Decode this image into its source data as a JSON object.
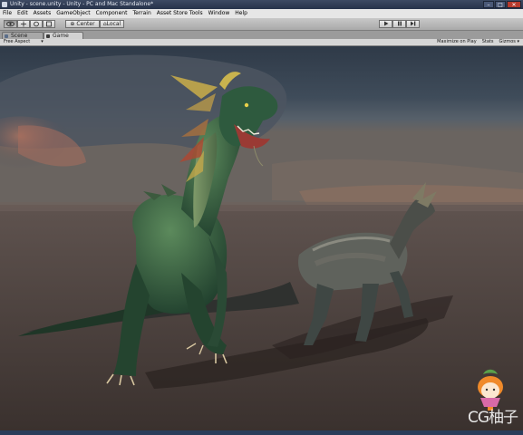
{
  "window": {
    "title": "Unity - scene.unity - Unity - PC and Mac Standalone*"
  },
  "menu": [
    "File",
    "Edit",
    "Assets",
    "GameObject",
    "Component",
    "Terrain",
    "Asset Store Tools",
    "Window",
    "Help"
  ],
  "toolbar": {
    "pivot_label": "Center",
    "space_label": "Local"
  },
  "tabs": {
    "scene": "Scene",
    "game": "Game"
  },
  "gamebar": {
    "aspect": "Free Aspect",
    "maximize": "Maximize on Play",
    "stats": "Stats",
    "gizmos": "Gizmos"
  },
  "watermark": {
    "text": "CG柚子"
  },
  "colors": {
    "sky_top": "#34404e",
    "ground": "#4f4340",
    "dragon": "#2f5a40",
    "menu_bg": "#e6e6e6"
  }
}
